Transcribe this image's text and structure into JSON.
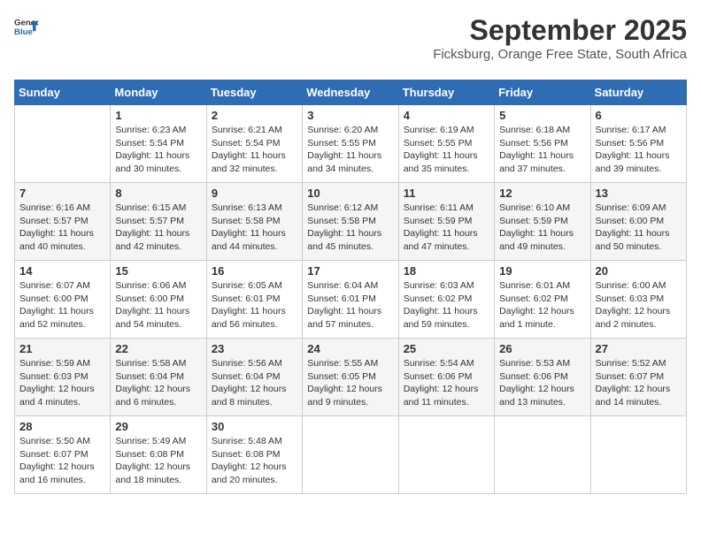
{
  "logo": {
    "line1": "General",
    "line2": "Blue"
  },
  "title": "September 2025",
  "location": "Ficksburg, Orange Free State, South Africa",
  "weekdays": [
    "Sunday",
    "Monday",
    "Tuesday",
    "Wednesday",
    "Thursday",
    "Friday",
    "Saturday"
  ],
  "weeks": [
    [
      {
        "day": "",
        "sunrise": "",
        "sunset": "",
        "daylight": ""
      },
      {
        "day": "1",
        "sunrise": "Sunrise: 6:23 AM",
        "sunset": "Sunset: 5:54 PM",
        "daylight": "Daylight: 11 hours and 30 minutes."
      },
      {
        "day": "2",
        "sunrise": "Sunrise: 6:21 AM",
        "sunset": "Sunset: 5:54 PM",
        "daylight": "Daylight: 11 hours and 32 minutes."
      },
      {
        "day": "3",
        "sunrise": "Sunrise: 6:20 AM",
        "sunset": "Sunset: 5:55 PM",
        "daylight": "Daylight: 11 hours and 34 minutes."
      },
      {
        "day": "4",
        "sunrise": "Sunrise: 6:19 AM",
        "sunset": "Sunset: 5:55 PM",
        "daylight": "Daylight: 11 hours and 35 minutes."
      },
      {
        "day": "5",
        "sunrise": "Sunrise: 6:18 AM",
        "sunset": "Sunset: 5:56 PM",
        "daylight": "Daylight: 11 hours and 37 minutes."
      },
      {
        "day": "6",
        "sunrise": "Sunrise: 6:17 AM",
        "sunset": "Sunset: 5:56 PM",
        "daylight": "Daylight: 11 hours and 39 minutes."
      }
    ],
    [
      {
        "day": "7",
        "sunrise": "Sunrise: 6:16 AM",
        "sunset": "Sunset: 5:57 PM",
        "daylight": "Daylight: 11 hours and 40 minutes."
      },
      {
        "day": "8",
        "sunrise": "Sunrise: 6:15 AM",
        "sunset": "Sunset: 5:57 PM",
        "daylight": "Daylight: 11 hours and 42 minutes."
      },
      {
        "day": "9",
        "sunrise": "Sunrise: 6:13 AM",
        "sunset": "Sunset: 5:58 PM",
        "daylight": "Daylight: 11 hours and 44 minutes."
      },
      {
        "day": "10",
        "sunrise": "Sunrise: 6:12 AM",
        "sunset": "Sunset: 5:58 PM",
        "daylight": "Daylight: 11 hours and 45 minutes."
      },
      {
        "day": "11",
        "sunrise": "Sunrise: 6:11 AM",
        "sunset": "Sunset: 5:59 PM",
        "daylight": "Daylight: 11 hours and 47 minutes."
      },
      {
        "day": "12",
        "sunrise": "Sunrise: 6:10 AM",
        "sunset": "Sunset: 5:59 PM",
        "daylight": "Daylight: 11 hours and 49 minutes."
      },
      {
        "day": "13",
        "sunrise": "Sunrise: 6:09 AM",
        "sunset": "Sunset: 6:00 PM",
        "daylight": "Daylight: 11 hours and 50 minutes."
      }
    ],
    [
      {
        "day": "14",
        "sunrise": "Sunrise: 6:07 AM",
        "sunset": "Sunset: 6:00 PM",
        "daylight": "Daylight: 11 hours and 52 minutes."
      },
      {
        "day": "15",
        "sunrise": "Sunrise: 6:06 AM",
        "sunset": "Sunset: 6:00 PM",
        "daylight": "Daylight: 11 hours and 54 minutes."
      },
      {
        "day": "16",
        "sunrise": "Sunrise: 6:05 AM",
        "sunset": "Sunset: 6:01 PM",
        "daylight": "Daylight: 11 hours and 56 minutes."
      },
      {
        "day": "17",
        "sunrise": "Sunrise: 6:04 AM",
        "sunset": "Sunset: 6:01 PM",
        "daylight": "Daylight: 11 hours and 57 minutes."
      },
      {
        "day": "18",
        "sunrise": "Sunrise: 6:03 AM",
        "sunset": "Sunset: 6:02 PM",
        "daylight": "Daylight: 11 hours and 59 minutes."
      },
      {
        "day": "19",
        "sunrise": "Sunrise: 6:01 AM",
        "sunset": "Sunset: 6:02 PM",
        "daylight": "Daylight: 12 hours and 1 minute."
      },
      {
        "day": "20",
        "sunrise": "Sunrise: 6:00 AM",
        "sunset": "Sunset: 6:03 PM",
        "daylight": "Daylight: 12 hours and 2 minutes."
      }
    ],
    [
      {
        "day": "21",
        "sunrise": "Sunrise: 5:59 AM",
        "sunset": "Sunset: 6:03 PM",
        "daylight": "Daylight: 12 hours and 4 minutes."
      },
      {
        "day": "22",
        "sunrise": "Sunrise: 5:58 AM",
        "sunset": "Sunset: 6:04 PM",
        "daylight": "Daylight: 12 hours and 6 minutes."
      },
      {
        "day": "23",
        "sunrise": "Sunrise: 5:56 AM",
        "sunset": "Sunset: 6:04 PM",
        "daylight": "Daylight: 12 hours and 8 minutes."
      },
      {
        "day": "24",
        "sunrise": "Sunrise: 5:55 AM",
        "sunset": "Sunset: 6:05 PM",
        "daylight": "Daylight: 12 hours and 9 minutes."
      },
      {
        "day": "25",
        "sunrise": "Sunrise: 5:54 AM",
        "sunset": "Sunset: 6:06 PM",
        "daylight": "Daylight: 12 hours and 11 minutes."
      },
      {
        "day": "26",
        "sunrise": "Sunrise: 5:53 AM",
        "sunset": "Sunset: 6:06 PM",
        "daylight": "Daylight: 12 hours and 13 minutes."
      },
      {
        "day": "27",
        "sunrise": "Sunrise: 5:52 AM",
        "sunset": "Sunset: 6:07 PM",
        "daylight": "Daylight: 12 hours and 14 minutes."
      }
    ],
    [
      {
        "day": "28",
        "sunrise": "Sunrise: 5:50 AM",
        "sunset": "Sunset: 6:07 PM",
        "daylight": "Daylight: 12 hours and 16 minutes."
      },
      {
        "day": "29",
        "sunrise": "Sunrise: 5:49 AM",
        "sunset": "Sunset: 6:08 PM",
        "daylight": "Daylight: 12 hours and 18 minutes."
      },
      {
        "day": "30",
        "sunrise": "Sunrise: 5:48 AM",
        "sunset": "Sunset: 6:08 PM",
        "daylight": "Daylight: 12 hours and 20 minutes."
      },
      {
        "day": "",
        "sunrise": "",
        "sunset": "",
        "daylight": ""
      },
      {
        "day": "",
        "sunrise": "",
        "sunset": "",
        "daylight": ""
      },
      {
        "day": "",
        "sunrise": "",
        "sunset": "",
        "daylight": ""
      },
      {
        "day": "",
        "sunrise": "",
        "sunset": "",
        "daylight": ""
      }
    ]
  ]
}
